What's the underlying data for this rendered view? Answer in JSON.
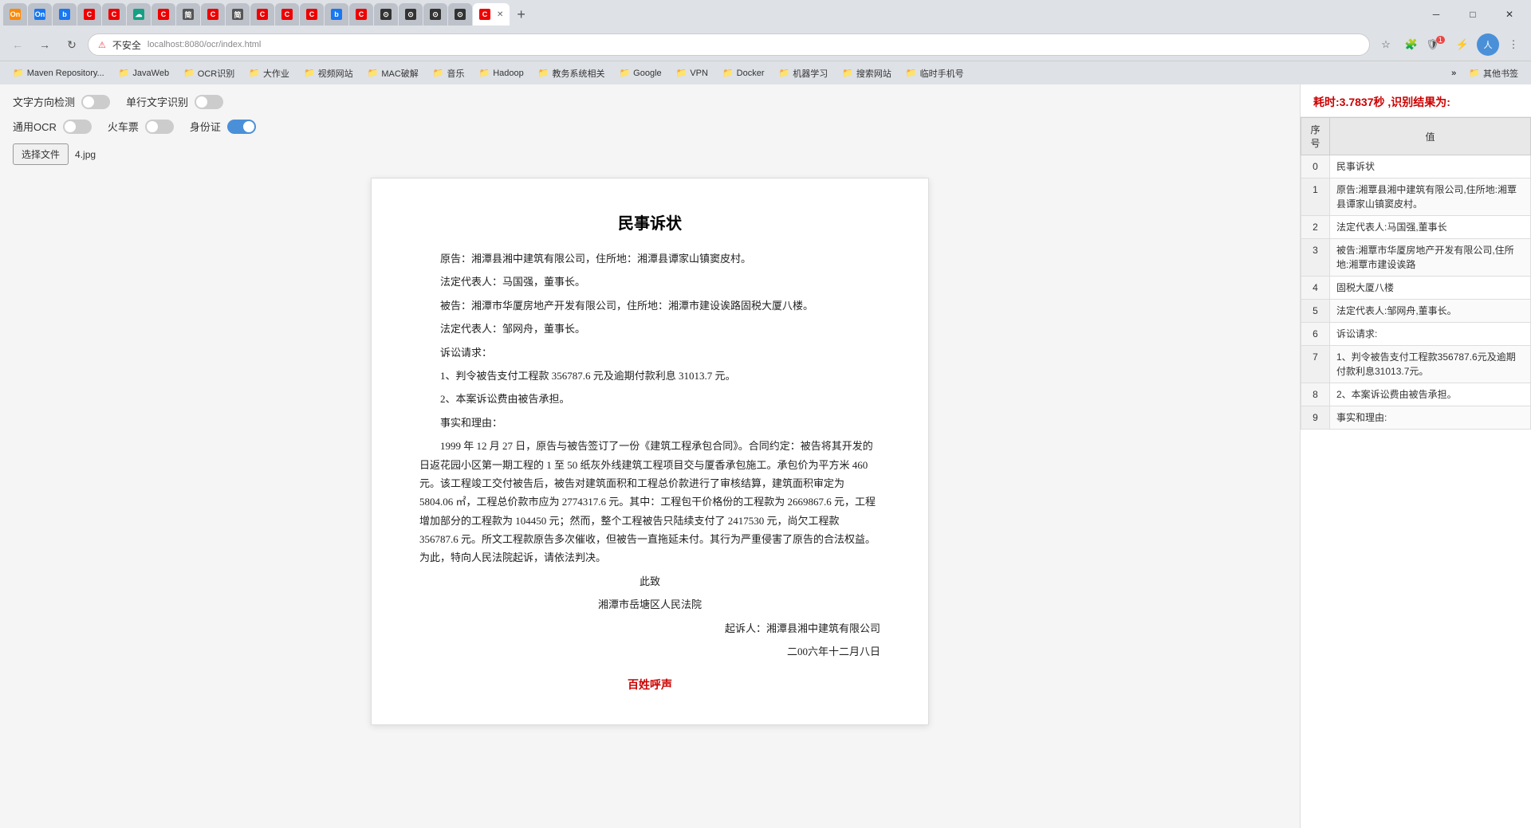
{
  "browser": {
    "tabs": [
      {
        "id": 1,
        "label": "On",
        "favicon": "On",
        "active": false,
        "favicon_color": "fav-orange"
      },
      {
        "id": 2,
        "label": "On",
        "favicon": "On",
        "active": false,
        "favicon_color": "fav-blue"
      },
      {
        "id": 3,
        "label": "",
        "favicon": "b",
        "active": false,
        "favicon_color": "fav-blue"
      },
      {
        "id": 4,
        "label": "",
        "favicon": "C",
        "active": false,
        "favicon_color": "fav-red"
      },
      {
        "id": 5,
        "label": "",
        "favicon": "C",
        "active": false,
        "favicon_color": "fav-red"
      },
      {
        "id": 6,
        "label": "",
        "favicon": "☁",
        "active": false,
        "favicon_color": "fav-teal"
      },
      {
        "id": 7,
        "label": "",
        "favicon": "C",
        "active": false,
        "favicon_color": "fav-red"
      },
      {
        "id": 8,
        "label": "",
        "favicon": "C",
        "active": true,
        "favicon_color": "fav-red"
      },
      {
        "id": 9,
        "label": "×",
        "favicon": "",
        "active": false,
        "favicon_color": "fav-gray"
      }
    ],
    "address": "不安全",
    "url": "localhost:...",
    "win_minimize": "─",
    "win_restore": "□",
    "win_close": "✕"
  },
  "bookmarks": [
    {
      "label": "Maven Repository...",
      "icon": "📁"
    },
    {
      "label": "JavaWeb",
      "icon": "📁"
    },
    {
      "label": "OCR识别",
      "icon": "📁"
    },
    {
      "label": "大作业",
      "icon": "📁"
    },
    {
      "label": "视频网站",
      "icon": "📁"
    },
    {
      "label": "MAC破解",
      "icon": "📁"
    },
    {
      "label": "音乐",
      "icon": "📁"
    },
    {
      "label": "Hadoop",
      "icon": "📁"
    },
    {
      "label": "教务系统相关",
      "icon": "📁"
    },
    {
      "label": "Google",
      "icon": "📁"
    },
    {
      "label": "VPN",
      "icon": "📁"
    },
    {
      "label": "Docker",
      "icon": "📁"
    },
    {
      "label": "机器学习",
      "icon": "📁"
    },
    {
      "label": "搜索网站",
      "icon": "📁"
    },
    {
      "label": "临时手机号",
      "icon": "📁"
    },
    {
      "label": "其他书签",
      "icon": "📁"
    }
  ],
  "controls": {
    "text_direction_label": "文字方向检测",
    "text_direction_state": "off",
    "single_line_label": "单行文字识别",
    "single_line_state": "off",
    "general_ocr_label": "通用OCR",
    "general_ocr_state": "off",
    "train_ticket_label": "火车票",
    "train_ticket_state": "off",
    "id_card_label": "身份证",
    "id_card_state": "on"
  },
  "file_selector": {
    "button_label": "选择文件",
    "file_name": "4.jpg"
  },
  "document": {
    "title": "民事诉状",
    "paragraphs": [
      "原告：湘潭县湘中建筑有限公司，住所地：湘潭县谭家山镇窦皮村。",
      "法定代表人：马国强，董事长。",
      "被告：湘潭市华厦房地产开发有限公司，住所地：湘潭市建设诶路固税大厦八楼。",
      "法定代表人：邹网舟，董事长。",
      "诉讼请求：",
      "1、判令被告支付工程款 356787.6 元及逾期付款利息 31013.7 元。",
      "2、本案诉讼费由被告承担。",
      "事实和理由：",
      "1999 年 12 月 27 日，原告与被告签订了一份《建筑工程承包合同》。合同约定：被告将其开发的日返花园小区第一期工程的 1 至 50 纸灰外线建筑工程项目交与厦香承包施工。承包价为平方米 460 元。该工程竣工交付被告后，被告对建筑面积和工程总价款进行了审核结算，建筑面积审定为 5804.06 ㎡，工程总价款市应为 2774317.6 元。其中：工程包干价格份的工程款为 2669867.6 元，工程增加部分的工程款为 104450 元；然而，整个工程被告只陆续支付了 2417530 元，尚欠工程款 356787.6 元。所文工程款原告多次催收，但被告一直拖延未付。其行为严重侵害了原告的合法权益。为此，特向人民法院起诉，请依法判决。",
      "此致",
      "湘潭市岳塘区人民法院",
      "起诉人：湘潭县湘中建筑有限公司",
      "二00六年十二月八日"
    ],
    "watermark": "百姓呼声"
  },
  "result": {
    "header": "耗时:3.7837秒 ,识别结果为:",
    "time_value": "3.7837",
    "columns": [
      "序号",
      "值"
    ],
    "rows": [
      {
        "index": 0,
        "value": "民事诉状"
      },
      {
        "index": 1,
        "value": "原告:湘覃县湘中建筑有限公司,住所地:湘覃县谭家山镇窦皮村。"
      },
      {
        "index": 2,
        "value": "法定代表人:马国强,董事长"
      },
      {
        "index": 3,
        "value": "被告:湘覃市华厦房地产开发有限公司,住所地:湘覃市建设诶路"
      },
      {
        "index": 4,
        "value": "固税大厦八楼"
      },
      {
        "index": 5,
        "value": "法定代表人:邹网舟,董事长。"
      },
      {
        "index": 6,
        "value": "诉讼请求:"
      },
      {
        "index": 7,
        "value": "1、判令被告支付工程款356787.6元及逾期付款利息31013.7元。"
      },
      {
        "index": 8,
        "value": "2、本案诉讼费由被告承担。"
      },
      {
        "index": 9,
        "value": "事实和理由:"
      }
    ]
  }
}
